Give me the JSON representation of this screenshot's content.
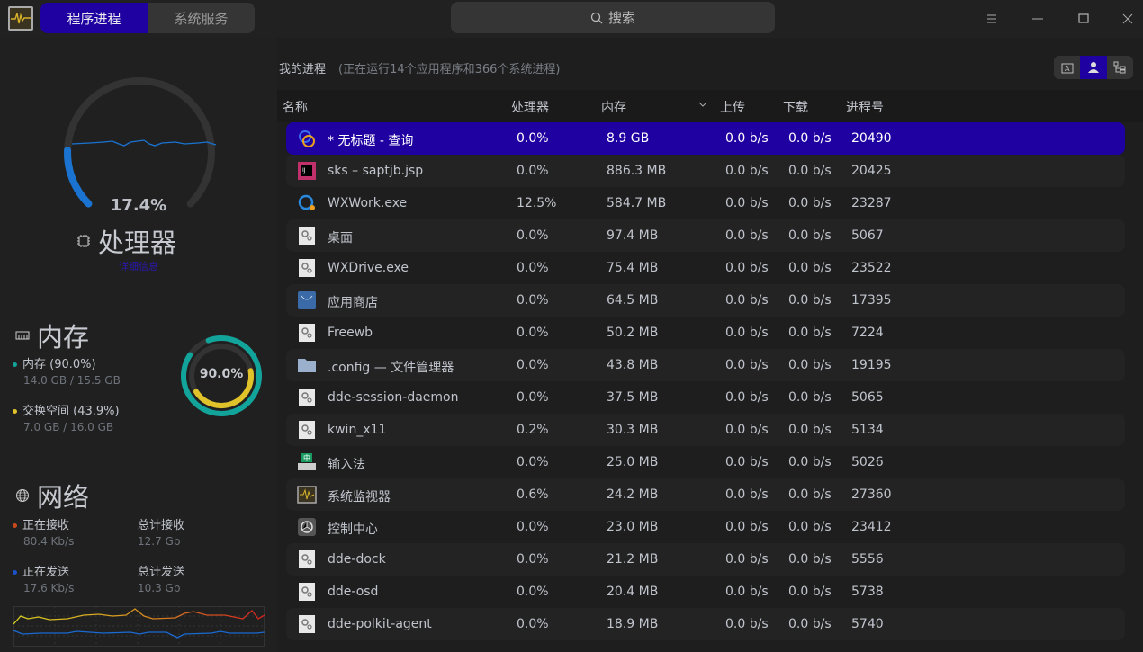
{
  "titlebar": {
    "tabs": [
      {
        "label": "程序进程",
        "active": true
      },
      {
        "label": "系统服务",
        "active": false
      }
    ],
    "search_placeholder": "搜索"
  },
  "cpu": {
    "percent_label": "17.4%",
    "percent": 17.4,
    "title": "处理器",
    "details_link": "详细信息",
    "color": "#1a73d1"
  },
  "memory": {
    "title": "内存",
    "mem_label": "内存 (90.0%)",
    "mem_value": "14.0 GB / 15.5 GB",
    "swap_label": "交换空间 (43.9%)",
    "swap_value": "7.0 GB / 16.0 GB",
    "ring_label": "90.0%",
    "mem_percent": 90.0,
    "swap_percent": 43.9,
    "mem_color": "#12a39b",
    "swap_color": "#e0c22b"
  },
  "network": {
    "title": "网络",
    "recv_label": "正在接收",
    "recv_value": "80.4 Kb/s",
    "total_recv_label": "总计接收",
    "total_recv_value": "12.7 Gb",
    "send_label": "正在发送",
    "send_value": "17.6 Kb/s",
    "total_send_label": "总计发送",
    "total_send_value": "10.3 Gb",
    "recv_color": "#c9491a",
    "send_color": "#1a52c9"
  },
  "main": {
    "heading": "我的进程",
    "summary": "(正在运行14个应用程序和366个系统进程)",
    "columns": [
      "名称",
      "处理器",
      "内存",
      "上传",
      "下载",
      "进程号"
    ],
    "processes": [
      {
        "name": "* 无标题 - 查询",
        "cpu": "0.0%",
        "mem": "8.9 GB",
        "up": "0.0 b/s",
        "down": "0.0 b/s",
        "pid": "20490",
        "icon": "db-app-icon"
      },
      {
        "name": "sks – saptjb.jsp",
        "cpu": "0.0%",
        "mem": "886.3 MB",
        "up": "0.0 b/s",
        "down": "0.0 b/s",
        "pid": "20425",
        "icon": "intellij-icon"
      },
      {
        "name": "WXWork.exe",
        "cpu": "12.5%",
        "mem": "584.7 MB",
        "up": "0.0 b/s",
        "down": "0.0 b/s",
        "pid": "23287",
        "icon": "wxwork-icon"
      },
      {
        "name": "桌面",
        "cpu": "0.0%",
        "mem": "97.4 MB",
        "up": "0.0 b/s",
        "down": "0.0 b/s",
        "pid": "5067",
        "icon": "gear-icon"
      },
      {
        "name": "WXDrive.exe",
        "cpu": "0.0%",
        "mem": "75.4 MB",
        "up": "0.0 b/s",
        "down": "0.0 b/s",
        "pid": "23522",
        "icon": "gear-icon"
      },
      {
        "name": "应用商店",
        "cpu": "0.0%",
        "mem": "64.5 MB",
        "up": "0.0 b/s",
        "down": "0.0 b/s",
        "pid": "17395",
        "icon": "app-store-icon"
      },
      {
        "name": "Freewb",
        "cpu": "0.0%",
        "mem": "50.2 MB",
        "up": "0.0 b/s",
        "down": "0.0 b/s",
        "pid": "7224",
        "icon": "gear-icon"
      },
      {
        "name": ".config — 文件管理器",
        "cpu": "0.0%",
        "mem": "43.8 MB",
        "up": "0.0 b/s",
        "down": "0.0 b/s",
        "pid": "19195",
        "icon": "folder-icon"
      },
      {
        "name": "dde-session-daemon",
        "cpu": "0.0%",
        "mem": "37.5 MB",
        "up": "0.0 b/s",
        "down": "0.0 b/s",
        "pid": "5065",
        "icon": "gear-icon"
      },
      {
        "name": "kwin_x11",
        "cpu": "0.2%",
        "mem": "30.3 MB",
        "up": "0.0 b/s",
        "down": "0.0 b/s",
        "pid": "5134",
        "icon": "gear-icon"
      },
      {
        "name": "输入法",
        "cpu": "0.0%",
        "mem": "25.0 MB",
        "up": "0.0 b/s",
        "down": "0.0 b/s",
        "pid": "5026",
        "icon": "keyboard-icon"
      },
      {
        "name": "系统监视器",
        "cpu": "0.6%",
        "mem": "24.2 MB",
        "up": "0.0 b/s",
        "down": "0.0 b/s",
        "pid": "27360",
        "icon": "monitor-icon"
      },
      {
        "name": "控制中心",
        "cpu": "0.0%",
        "mem": "23.0 MB",
        "up": "0.0 b/s",
        "down": "0.0 b/s",
        "pid": "23412",
        "icon": "settings-icon"
      },
      {
        "name": "dde-dock",
        "cpu": "0.0%",
        "mem": "21.2 MB",
        "up": "0.0 b/s",
        "down": "0.0 b/s",
        "pid": "5556",
        "icon": "gear-icon"
      },
      {
        "name": "dde-osd",
        "cpu": "0.0%",
        "mem": "20.4 MB",
        "up": "0.0 b/s",
        "down": "0.0 b/s",
        "pid": "5738",
        "icon": "gear-icon"
      },
      {
        "name": "dde-polkit-agent",
        "cpu": "0.0%",
        "mem": "18.9 MB",
        "up": "0.0 b/s",
        "down": "0.0 b/s",
        "pid": "5740",
        "icon": "gear-icon"
      }
    ]
  },
  "accent": "#1f00a0"
}
